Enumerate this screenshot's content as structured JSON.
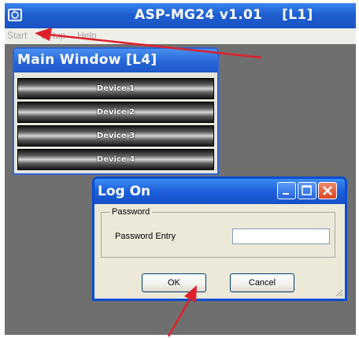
{
  "app": {
    "title": "ASP-MG24 v1.01    [L1]"
  },
  "menu": [
    "Start",
    "Setup",
    "Help"
  ],
  "main_window": {
    "title": "Main Window [L4]",
    "devices": [
      "Device 1",
      "Device 2",
      "Device 3",
      "Device 4"
    ]
  },
  "logon": {
    "title": "Log On",
    "group_label": "Password",
    "field_label": "Password Entry",
    "field_value": "",
    "ok": "OK",
    "cancel": "Cancel"
  },
  "colors": {
    "titlebar": "#1f5fd0",
    "close_button": "#dd4420",
    "annotation_arrow": "#e0202a",
    "background": "#6f6f6f"
  },
  "icons": [
    "app-icon",
    "minimize-icon",
    "maximize-icon",
    "close-icon",
    "resize-grip-icon"
  ]
}
